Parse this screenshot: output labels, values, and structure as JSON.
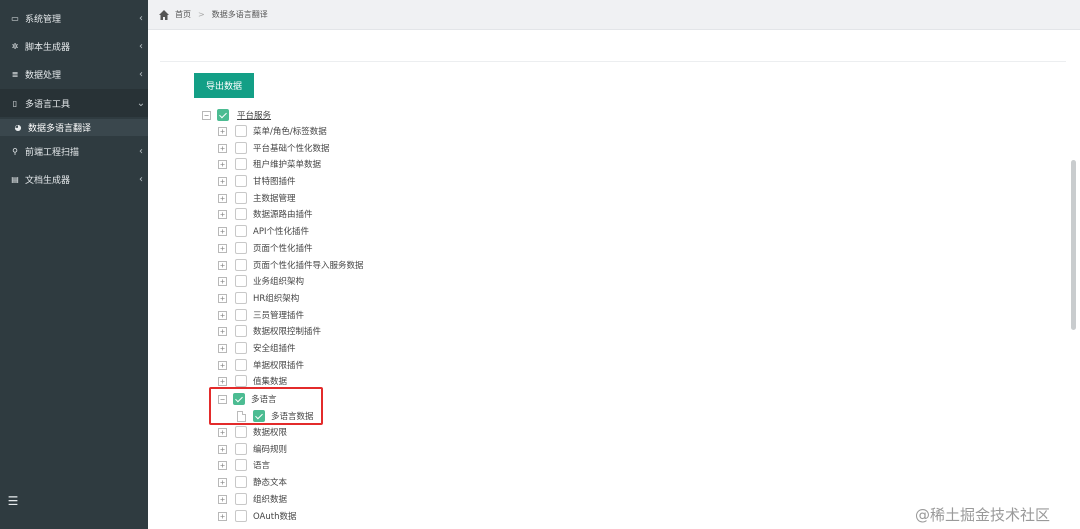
{
  "sidebar": {
    "items": [
      {
        "label": "系统管理",
        "icon": "monitor-icon",
        "glyph": "▭",
        "arrow": "‹"
      },
      {
        "label": "脚本生成器",
        "icon": "gear-icon",
        "glyph": "✲",
        "arrow": "‹"
      },
      {
        "label": "数据处理",
        "icon": "database-icon",
        "glyph": "≣",
        "arrow": "‹"
      },
      {
        "label": "多语言工具",
        "icon": "book-icon",
        "glyph": "▯",
        "arrow": "⌄"
      },
      {
        "label": "数据多语言翻译",
        "icon": "dashboard-icon",
        "glyph": "◕",
        "arrow": ""
      },
      {
        "label": "前端工程扫描",
        "icon": "search-icon",
        "glyph": "⚲",
        "arrow": "‹"
      },
      {
        "label": "文档生成器",
        "icon": "document-icon",
        "glyph": "▤",
        "arrow": "‹"
      }
    ],
    "toggle_glyph": "☰"
  },
  "breadcrumb": {
    "home": "首页",
    "separator": ">",
    "current": "数据多语言翻译"
  },
  "toolbar": {
    "export_label": "导出数据"
  },
  "tree": {
    "root": {
      "label": "平台服务",
      "toggle": "−",
      "checked": true
    },
    "children": [
      {
        "label": "菜单/角色/标签数据",
        "toggle": "+",
        "checked": false
      },
      {
        "label": "平台基础个性化数据",
        "toggle": "+",
        "checked": false
      },
      {
        "label": "租户维护菜单数据",
        "toggle": "+",
        "checked": false
      },
      {
        "label": "甘特图插件",
        "toggle": "+",
        "checked": false
      },
      {
        "label": "主数据管理",
        "toggle": "+",
        "checked": false
      },
      {
        "label": "数据源路由插件",
        "toggle": "+",
        "checked": false
      },
      {
        "label": "API个性化插件",
        "toggle": "+",
        "checked": false
      },
      {
        "label": "页面个性化插件",
        "toggle": "+",
        "checked": false
      },
      {
        "label": "页面个性化插件导入服务数据",
        "toggle": "+",
        "checked": false
      },
      {
        "label": "业务组织架构",
        "toggle": "+",
        "checked": false
      },
      {
        "label": "HR组织架构",
        "toggle": "+",
        "checked": false
      },
      {
        "label": "三员管理插件",
        "toggle": "+",
        "checked": false
      },
      {
        "label": "数据权限控制插件",
        "toggle": "+",
        "checked": false
      },
      {
        "label": "安全组插件",
        "toggle": "+",
        "checked": false
      },
      {
        "label": "单据权限插件",
        "toggle": "+",
        "checked": false
      },
      {
        "label": "值集数据",
        "toggle": "+",
        "checked": false
      },
      {
        "label": "多语言",
        "toggle": "−",
        "checked": true
      },
      {
        "label": "多语言数据",
        "toggle": "",
        "checked": true,
        "leaf": true
      },
      {
        "label": "数据权限",
        "toggle": "+",
        "checked": false
      },
      {
        "label": "编码规则",
        "toggle": "+",
        "checked": false
      },
      {
        "label": "语言",
        "toggle": "+",
        "checked": false
      },
      {
        "label": "静态文本",
        "toggle": "+",
        "checked": false
      },
      {
        "label": "组织数据",
        "toggle": "+",
        "checked": false
      },
      {
        "label": "OAuth数据",
        "toggle": "+",
        "checked": false
      }
    ]
  },
  "watermark": "@稀土掘金技术社区",
  "colors": {
    "sidebar_bg": "#2f3b40",
    "accent": "#139f86",
    "checkbox_checked": "#4cbc92",
    "highlight": "#e32b2b"
  }
}
